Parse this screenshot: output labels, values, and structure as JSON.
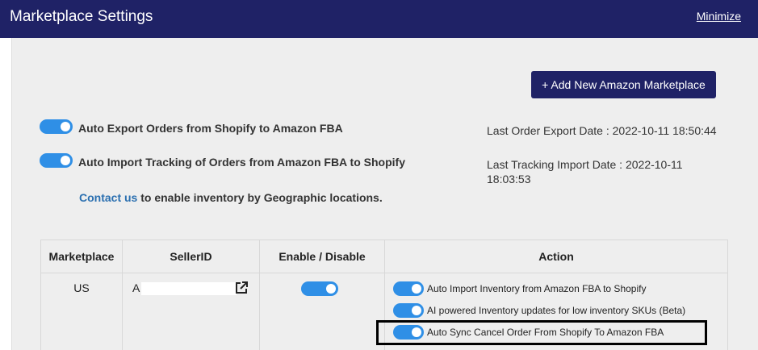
{
  "header": {
    "title": "Marketplace Settings",
    "minimize_label": "Minimize"
  },
  "actions": {
    "add_marketplace_label": "+ Add New Amazon Marketplace"
  },
  "settings": {
    "auto_export": {
      "label": "Auto Export Orders from Shopify to Amazon FBA",
      "enabled": true
    },
    "auto_import_tracking": {
      "label": "Auto Import Tracking of Orders from Amazon FBA to Shopify",
      "enabled": true
    }
  },
  "status": {
    "last_export": "Last Order Export Date : 2022-10-11 18:50:44",
    "last_tracking": "Last Tracking Import Date : 2022-10-11 18:03:53"
  },
  "contact": {
    "link_text": "Contact us",
    "rest_text": " to enable inventory by Geographic locations."
  },
  "table": {
    "headers": [
      "Marketplace",
      "SellerID",
      "Enable / Disable",
      "Action"
    ],
    "rows": [
      {
        "marketplace": "US",
        "seller_id_visible": "A",
        "enabled": true,
        "actions": [
          {
            "label": "Auto Import Inventory from Amazon FBA to Shopify",
            "enabled": true
          },
          {
            "label": "AI powered Inventory updates for low inventory SKUs (Beta)",
            "enabled": true
          },
          {
            "label": "Auto Sync Cancel Order From Shopify To Amazon FBA",
            "enabled": true
          }
        ]
      }
    ]
  },
  "colors": {
    "header_bg": "#1f2266",
    "toggle_on": "#2f8fe6",
    "link": "#2a6fb0",
    "panel_bg": "#eeeeee"
  }
}
